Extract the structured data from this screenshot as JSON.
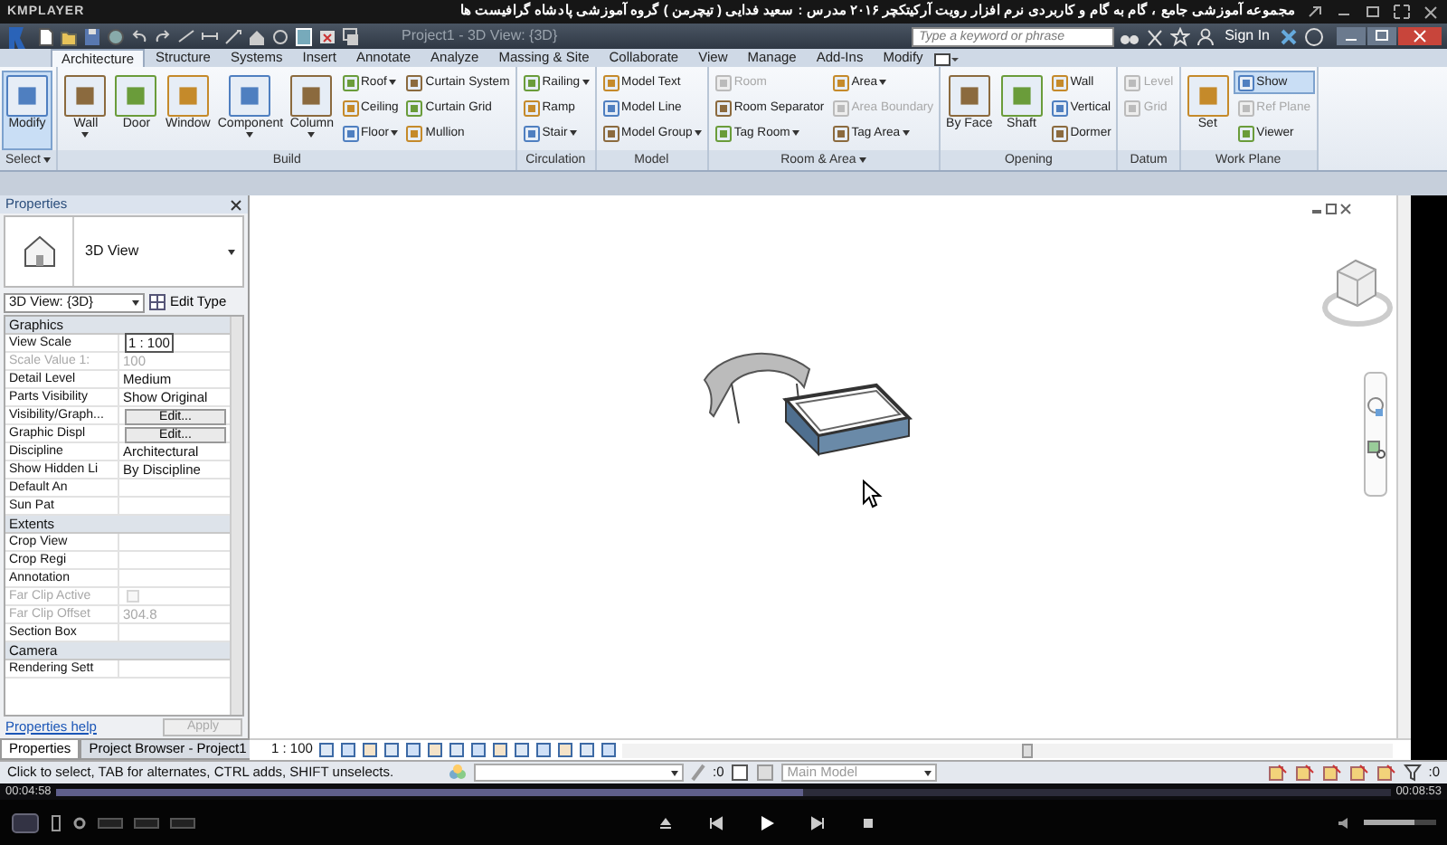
{
  "player": {
    "brand": "KMPLAYER",
    "title": "مجموعه آموزشی جامع ، گام به گام و کاربردی نرم افزار رویت آرکیتکچر ۲۰۱۶   مدرس : سعید فدایی ( تیچرمن ) گروه آموزشی پادشاه گرافیست ها",
    "elapsed": "00:04:58",
    "total": "00:08:53",
    "progress": {
      "level": 0.56
    },
    "volume": {
      "level": 0.7
    }
  },
  "app": {
    "title": "Project1 - 3D View: {3D}",
    "search": {
      "placeholder": "Type a keyword or phrase"
    },
    "sign_in": "Sign In"
  },
  "ribbon": {
    "tabs": [
      {
        "label": "Architecture",
        "selected": true
      },
      {
        "label": "Structure",
        "selected": false
      },
      {
        "label": "Systems",
        "selected": false
      },
      {
        "label": "Insert",
        "selected": false
      },
      {
        "label": "Annotate",
        "selected": false
      },
      {
        "label": "Analyze",
        "selected": false
      },
      {
        "label": "Massing & Site",
        "selected": false
      },
      {
        "label": "Collaborate",
        "selected": false
      },
      {
        "label": "View",
        "selected": false
      },
      {
        "label": "Manage",
        "selected": false
      },
      {
        "label": "Add-Ins",
        "selected": false
      },
      {
        "label": "Modify",
        "selected": false
      }
    ],
    "panels": [
      {
        "label": "Select",
        "dropdown": true,
        "tools": [
          {
            "label": "Modify",
            "kind": "large",
            "selected": true,
            "disabled": false,
            "dropdown": false
          }
        ]
      },
      {
        "label": "Build",
        "dropdown": false,
        "tools": [
          {
            "label": "Wall",
            "kind": "large",
            "selected": false,
            "disabled": false,
            "dropdown": true
          },
          {
            "label": "Door",
            "kind": "large",
            "selected": false,
            "disabled": false,
            "dropdown": false
          },
          {
            "label": "Window",
            "kind": "large",
            "selected": false,
            "disabled": false,
            "dropdown": false
          },
          {
            "label": "Component",
            "kind": "large",
            "selected": false,
            "disabled": false,
            "dropdown": true
          },
          {
            "label": "Column",
            "kind": "large",
            "selected": false,
            "disabled": false,
            "dropdown": true
          },
          {
            "label": "Roof",
            "kind": "small",
            "selected": false,
            "disabled": false,
            "dropdown": true
          },
          {
            "label": "Ceiling",
            "kind": "small",
            "selected": false,
            "disabled": false,
            "dropdown": false
          },
          {
            "label": "Floor",
            "kind": "small",
            "selected": false,
            "disabled": false,
            "dropdown": true
          },
          {
            "label": "Curtain System",
            "kind": "small",
            "selected": false,
            "disabled": false,
            "dropdown": false
          },
          {
            "label": "Curtain Grid",
            "kind": "small",
            "selected": false,
            "disabled": false,
            "dropdown": false
          },
          {
            "label": "Mullion",
            "kind": "small",
            "selected": false,
            "disabled": false,
            "dropdown": false
          }
        ]
      },
      {
        "label": "Circulation",
        "dropdown": false,
        "tools": [
          {
            "label": "Railing",
            "kind": "small",
            "selected": false,
            "disabled": false,
            "dropdown": true
          },
          {
            "label": "Ramp",
            "kind": "small",
            "selected": false,
            "disabled": false,
            "dropdown": false
          },
          {
            "label": "Stair",
            "kind": "small",
            "selected": false,
            "disabled": false,
            "dropdown": true
          }
        ]
      },
      {
        "label": "Model",
        "dropdown": false,
        "tools": [
          {
            "label": "Model Text",
            "kind": "small",
            "selected": false,
            "disabled": false,
            "dropdown": false
          },
          {
            "label": "Model Line",
            "kind": "small",
            "selected": false,
            "disabled": false,
            "dropdown": false
          },
          {
            "label": "Model Group",
            "kind": "small",
            "selected": false,
            "disabled": false,
            "dropdown": true
          }
        ]
      },
      {
        "label": "Room & Area",
        "dropdown": true,
        "tools": [
          {
            "label": "Room",
            "kind": "small",
            "selected": false,
            "disabled": true,
            "dropdown": false
          },
          {
            "label": "Room Separator",
            "kind": "small",
            "selected": false,
            "disabled": false,
            "dropdown": false
          },
          {
            "label": "Tag Room",
            "kind": "small",
            "selected": false,
            "disabled": false,
            "dropdown": true
          },
          {
            "label": "Area",
            "kind": "small",
            "selected": false,
            "disabled": false,
            "dropdown": true
          },
          {
            "label": "Area Boundary",
            "kind": "small",
            "selected": false,
            "disabled": true,
            "dropdown": false
          },
          {
            "label": "Tag Area",
            "kind": "small",
            "selected": false,
            "disabled": false,
            "dropdown": true
          }
        ]
      },
      {
        "label": "Opening",
        "dropdown": false,
        "tools": [
          {
            "label": "By Face",
            "kind": "large",
            "selected": false,
            "disabled": false,
            "dropdown": false
          },
          {
            "label": "Shaft",
            "kind": "large",
            "selected": false,
            "disabled": false,
            "dropdown": false
          },
          {
            "label": "Wall",
            "kind": "small",
            "selected": false,
            "disabled": false,
            "dropdown": false
          },
          {
            "label": "Vertical",
            "kind": "small",
            "selected": false,
            "disabled": false,
            "dropdown": false
          },
          {
            "label": "Dormer",
            "kind": "small",
            "selected": false,
            "disabled": false,
            "dropdown": false
          }
        ]
      },
      {
        "label": "Datum",
        "dropdown": false,
        "tools": [
          {
            "label": "Level",
            "kind": "small",
            "selected": false,
            "disabled": true,
            "dropdown": false
          },
          {
            "label": "Grid",
            "kind": "small",
            "selected": false,
            "disabled": true,
            "dropdown": false
          }
        ]
      },
      {
        "label": "Work Plane",
        "dropdown": false,
        "tools": [
          {
            "label": "Set",
            "kind": "large",
            "selected": false,
            "disabled": false,
            "dropdown": false
          },
          {
            "label": "Show",
            "kind": "small",
            "selected": true,
            "disabled": false,
            "dropdown": false
          },
          {
            "label": "Ref Plane",
            "kind": "small",
            "selected": false,
            "disabled": true,
            "dropdown": false
          },
          {
            "label": "Viewer",
            "kind": "small",
            "selected": false,
            "disabled": false,
            "dropdown": false
          }
        ]
      }
    ]
  },
  "properties": {
    "title": "Properties",
    "type_name": "3D View",
    "selector": "3D View: {3D}",
    "edit_type": "Edit Type",
    "sections": [
      {
        "name": "Graphics",
        "rows": [
          {
            "name": "View Scale",
            "value": "1 : 100",
            "kind": "field",
            "disabled": false
          },
          {
            "name": "Scale Value    1:",
            "value": "100",
            "kind": "text",
            "disabled": true
          },
          {
            "name": "Detail Level",
            "value": "Medium",
            "kind": "text",
            "disabled": false
          },
          {
            "name": "Parts Visibility",
            "value": "Show Original",
            "kind": "text",
            "disabled": false
          },
          {
            "name": "Visibility/Graph...",
            "value": "Edit...",
            "kind": "button",
            "disabled": false
          },
          {
            "name": "Graphic Displ",
            "value": "Edit...",
            "kind": "button",
            "disabled": false
          },
          {
            "name": "Discipline",
            "value": "Architectural",
            "kind": "text",
            "disabled": false
          },
          {
            "name": "Show Hidden Li",
            "value": "By Discipline",
            "kind": "text",
            "disabled": false
          },
          {
            "name": "Default An",
            "kind": "text",
            "disabled": false
          },
          {
            "name": "Sun Pat",
            "kind": "text",
            "disabled": false
          }
        ]
      },
      {
        "name": "Extents",
        "rows": [
          {
            "name": "Crop View",
            "kind": "text",
            "disabled": false
          },
          {
            "name": "Crop Regi",
            "kind": "text",
            "disabled": false
          },
          {
            "name": "Annotation",
            "kind": "text",
            "disabled": false
          },
          {
            "name": "Far Clip Active",
            "kind": "checkbox",
            "checked": false,
            "disabled": true
          },
          {
            "name": "Far Clip Offset",
            "value": "304.8",
            "kind": "text",
            "disabled": true
          },
          {
            "name": "Section Box",
            "kind": "text",
            "disabled": false
          }
        ]
      },
      {
        "name": "Camera",
        "rows": [
          {
            "name": "Rendering Sett",
            "kind": "text",
            "disabled": false
          }
        ]
      }
    ],
    "help": "Properties help",
    "apply": "Apply"
  },
  "bottom_tabs": [
    {
      "label": "Properties",
      "selected": true
    },
    {
      "label": "Project Browser - Project1",
      "selected": false
    }
  ],
  "view_bar": {
    "scale": "1 : 100"
  },
  "status_bar": {
    "message": "Click to select, TAB for alternates, CTRL adds, SHIFT unselects.",
    "selection_count": ":0",
    "workset": "Main Model",
    "filter_count": ":0"
  }
}
